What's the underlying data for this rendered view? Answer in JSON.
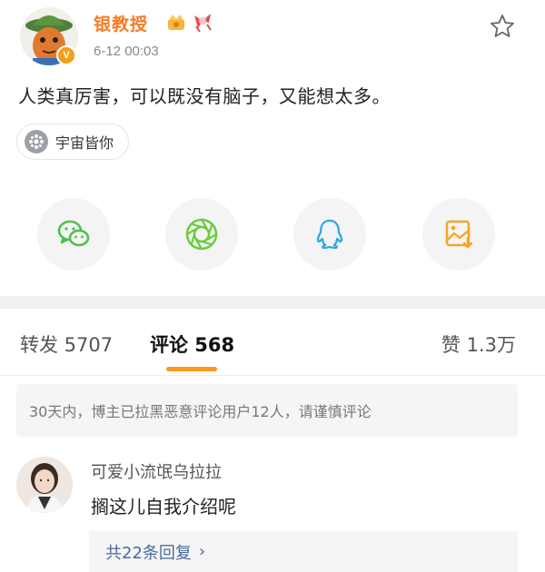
{
  "post": {
    "username": "银教授",
    "timestamp": "6-12 00:03",
    "verified_badge": "V",
    "text": "人类真厉害，可以既没有脑子，又能想太多。",
    "topic": "宇宙皆你"
  },
  "share": {
    "items": [
      {
        "icon": "wechat-icon",
        "color": "#4cbf4b"
      },
      {
        "icon": "moments-icon",
        "color": "#6ccb3e"
      },
      {
        "icon": "qq-icon",
        "color": "#2ea8e6"
      },
      {
        "icon": "save-image-icon",
        "color": "#f5a623"
      }
    ]
  },
  "tabs": {
    "repost": "转发 5707",
    "comment": "评论 568",
    "like": "赞 1.3万"
  },
  "notice": "30天内，博主已拉黑恶意评论用户12人，请谨慎评论",
  "comment": {
    "username": "可爱小流氓乌拉拉",
    "text": "搁这儿自我介绍呢",
    "replies": "共22条回复",
    "chevron": "›"
  },
  "colors": {
    "username": "#f57c27",
    "accent": "#f79a1e",
    "link": "#4a6a9c"
  }
}
